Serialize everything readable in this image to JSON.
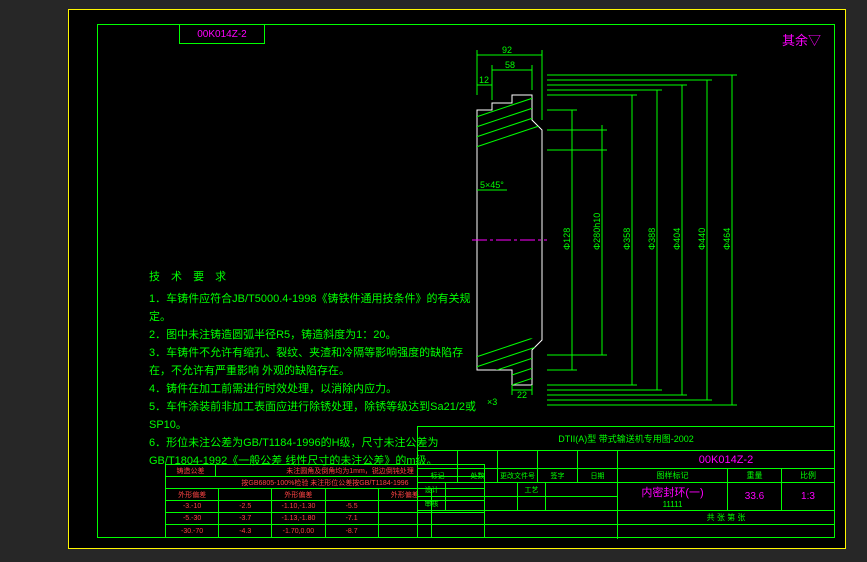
{
  "part_number": "00K014Z-2",
  "corner_note": "其余▽",
  "tech_req": {
    "title": "技 术 要 求",
    "items": [
      "1．车铸件应符合JB/T5000.4-1998《铸铁件通用技条件》的有关规定。",
      "2．图中未注铸造圆弧半径R5，铸造斜度为1：20。",
      "3．车铸件不允许有缩孔、裂纹、夹渣和冷隔等影响强度的缺陷存在，不允许有严重影响 外观的缺陷存在。",
      "4．铸件在加工前需进行时效处理，以消除内应力。",
      "5．车件涂装前非加工表面应进行除锈处理，除锈等级达到Sa21/2或 SP10。",
      "6．形位未注公差为GB/T1184-1996的H级，尺寸未注公差为GB/T1804-1992《一般公差 线性尺寸的未注公差》的m级。"
    ]
  },
  "drawing": {
    "top_dims": [
      "92",
      "58",
      "12"
    ],
    "chamfer": "5×45°",
    "bottom_dims": [
      "22",
      "×3"
    ],
    "dia_dims": [
      "Φ128",
      "Φ280h10",
      "Φ358",
      "Φ388",
      "Φ404",
      "Φ440",
      "Φ464"
    ]
  },
  "titleblock": {
    "title": "DTII(A)型  带式输送机专用图-2002",
    "part_name": "内密封环(一)",
    "code": "11111",
    "cols_sig": [
      "标记",
      "处数",
      "更改文件号",
      "签字",
      "日期"
    ],
    "row_labels": [
      "设计",
      "审核",
      "工艺"
    ],
    "prop": {
      "ratio_label": "图样标记",
      "weight_label": "重量",
      "scale_label": "比例",
      "weight": "33.6",
      "scale": "1:3",
      "sheet": "共   张   第   张"
    }
  },
  "tol_table": {
    "header1": "铸造公差",
    "note1": "未注圆角及倒角均为1mm，锐边倒钝处理",
    "note2": "按GB6805-100%检验  未注形位公差按GB/T1184-1996",
    "head_row": [
      "外形偏差",
      "",
      "外形偏差",
      "",
      "外形偏差",
      ""
    ],
    "rows": [
      [
        "-3.-10",
        "-2.5",
        "-1.10,-1.30",
        "-5.5",
        "",
        ""
      ],
      [
        "-5.-30",
        "-3.7",
        "-1.13,-1.80",
        "-7.1",
        "",
        ""
      ],
      [
        "-30.-70",
        "-4.3",
        "-1.70,0.00",
        "-8.7",
        "",
        ""
      ]
    ]
  }
}
